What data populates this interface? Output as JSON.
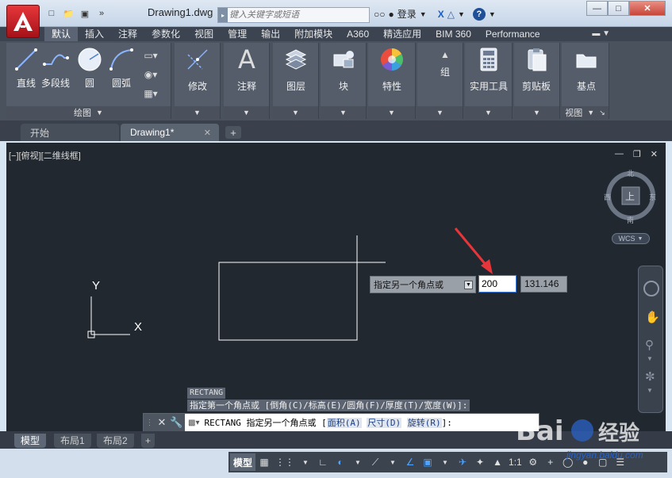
{
  "title_bar": {
    "document_title": "Drawing1.dwg",
    "search_placeholder": "键入关键字或短语",
    "login_label": "登录"
  },
  "ribbon_tabs": [
    "默认",
    "插入",
    "注释",
    "参数化",
    "视图",
    "管理",
    "输出",
    "附加模块",
    "A360",
    "精选应用",
    "BIM 360",
    "Performance"
  ],
  "ribbon_panels": {
    "draw": {
      "footer": "绘图",
      "tools": [
        "直线",
        "多段线",
        "圆",
        "圆弧"
      ]
    },
    "modify": {
      "label": "修改"
    },
    "annotation": {
      "label": "注释"
    },
    "layers": {
      "label": "图层"
    },
    "block": {
      "label": "块"
    },
    "properties": {
      "label": "特性"
    },
    "groups": {
      "label": "组"
    },
    "utilities": {
      "label": "实用工具"
    },
    "clipboard": {
      "label": "剪贴板"
    },
    "view": {
      "label": "基点",
      "footer": "视图"
    }
  },
  "doc_tabs": {
    "start": "开始",
    "drawing": "Drawing1*"
  },
  "viewport": {
    "label": "[−][俯视][二维线框]",
    "viewcube_top": "上",
    "compass": {
      "north": "北",
      "south": "南",
      "east": "东",
      "west": "西"
    },
    "wcs": "WCS",
    "ucs_x": "X",
    "ucs_y": "Y"
  },
  "dynamic_input": {
    "prompt": "指定另一个角点或",
    "value_1": "200",
    "value_2": "131.146"
  },
  "command": {
    "history_1": "RECTANG",
    "history_2": "指定第一个角点或 [倒角(C)/标高(E)/圆角(F)/厚度(T)/宽度(W)]:",
    "prefix": "RECTANG 指定另一个角点或 [",
    "option_1": "面积(A)",
    "option_2": "尺寸(D)",
    "option_3": "旋转(R)",
    "suffix": "]:"
  },
  "layout_tabs": [
    "模型",
    "布局1",
    "布局2"
  ],
  "status_bar": {
    "model": "模型",
    "scale": "1:1"
  },
  "watermark": {
    "url": "jingyan.baidu.com"
  },
  "colors": {
    "canvas_bg": "#212830",
    "ribbon_bg": "#4a525d",
    "accent_red": "#e2363a",
    "arrow_red": "#e8353a"
  }
}
